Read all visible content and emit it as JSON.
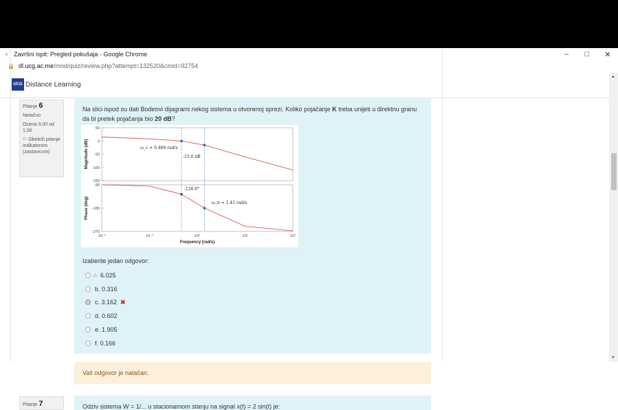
{
  "window": {
    "title": "Završni ispit: Pregled pokušaja - Google Chrome",
    "controls": {
      "minimize": "–",
      "maximize": "□",
      "close": "✕"
    }
  },
  "address": {
    "host": "dl.ucg.ac.me",
    "path": "/mod/quiz/review.php?attempt=132520&cmid=92754"
  },
  "site": {
    "logo_text": "UCG",
    "name": "Distance Learning"
  },
  "question6": {
    "number_label": "Pitanje",
    "number": "6",
    "status": "Netačno",
    "grade": "Ocena 0,00 od 1,00",
    "flag_label": "Obeleži pitanje indikatorom (zastavicom)",
    "text_part1": "Na slici ispod su dati Bodeovi dijagrami nekog sistema u otvorenoj sprezi. Koliko pojačanje ",
    "text_bold_k": "K",
    "text_part2": " treba unijeti u direktnu granu da bi pretek pojačanja bio ",
    "text_bold_db": "20 dB",
    "text_part3": "?",
    "prompt": "Izaberite jedan odgovor:",
    "options": [
      {
        "label": "a. 6.025",
        "display": "6.025",
        "checked": false
      },
      {
        "label": "b. 0.316",
        "checked": false
      },
      {
        "label": "c. 3.162",
        "checked": true,
        "incorrect": true
      },
      {
        "label": "d. 0.602",
        "checked": false
      },
      {
        "label": "e. 1.905",
        "checked": false
      },
      {
        "label": "f. 0.166",
        "checked": false
      }
    ],
    "feedback": "Vaš odgovor je natačan."
  },
  "question7": {
    "number_label": "Pitanje",
    "number": "7",
    "text": "Odziv sistema W = 1/... u stacionarnom stanju na signal x(t) = 2 sin(t) je:"
  },
  "chart_data": [
    {
      "type": "line",
      "title": "",
      "xlabel": "",
      "ylabel": "Magnitude (dB)",
      "x_scale": "log",
      "xlim": [
        0.01,
        100
      ],
      "ylim": [
        -150,
        50
      ],
      "yticks": [
        "50",
        "0",
        "-50",
        "-100",
        "-150"
      ],
      "series": [
        {
          "x": [
            0.01,
            0.1,
            0.466,
            1.41,
            10,
            100
          ],
          "values": [
            15,
            8,
            0,
            -15.6,
            -60,
            -110
          ]
        }
      ],
      "annotations": [
        "ω_c = 0.466 rad/s",
        "-15.6 dB"
      ]
    },
    {
      "type": "line",
      "title": "",
      "xlabel": "Frequency  (rad/s)",
      "ylabel": "Phase (deg)",
      "x_scale": "log",
      "xlim": [
        0.01,
        100
      ],
      "ylim": [
        -270,
        -90
      ],
      "yticks": [
        "-90",
        "-180",
        "-270"
      ],
      "xticks": [
        "10⁻²",
        "10⁻¹",
        "10⁰",
        "10¹",
        "10²"
      ],
      "series": [
        {
          "x": [
            0.01,
            0.1,
            0.466,
            1.41,
            10,
            100
          ],
          "values": [
            -90,
            -95,
            -126.6,
            -180,
            -250,
            -268
          ]
        }
      ],
      "annotations": [
        "-126.6°",
        "ω_π = 1.41 rad/s"
      ]
    }
  ],
  "colors": {
    "question_bg": "#def2f8",
    "feedback_bg": "#fcefdc",
    "curve": "#d9534f",
    "marker": "#1f5fa8",
    "incorrect": "#c0392b"
  }
}
